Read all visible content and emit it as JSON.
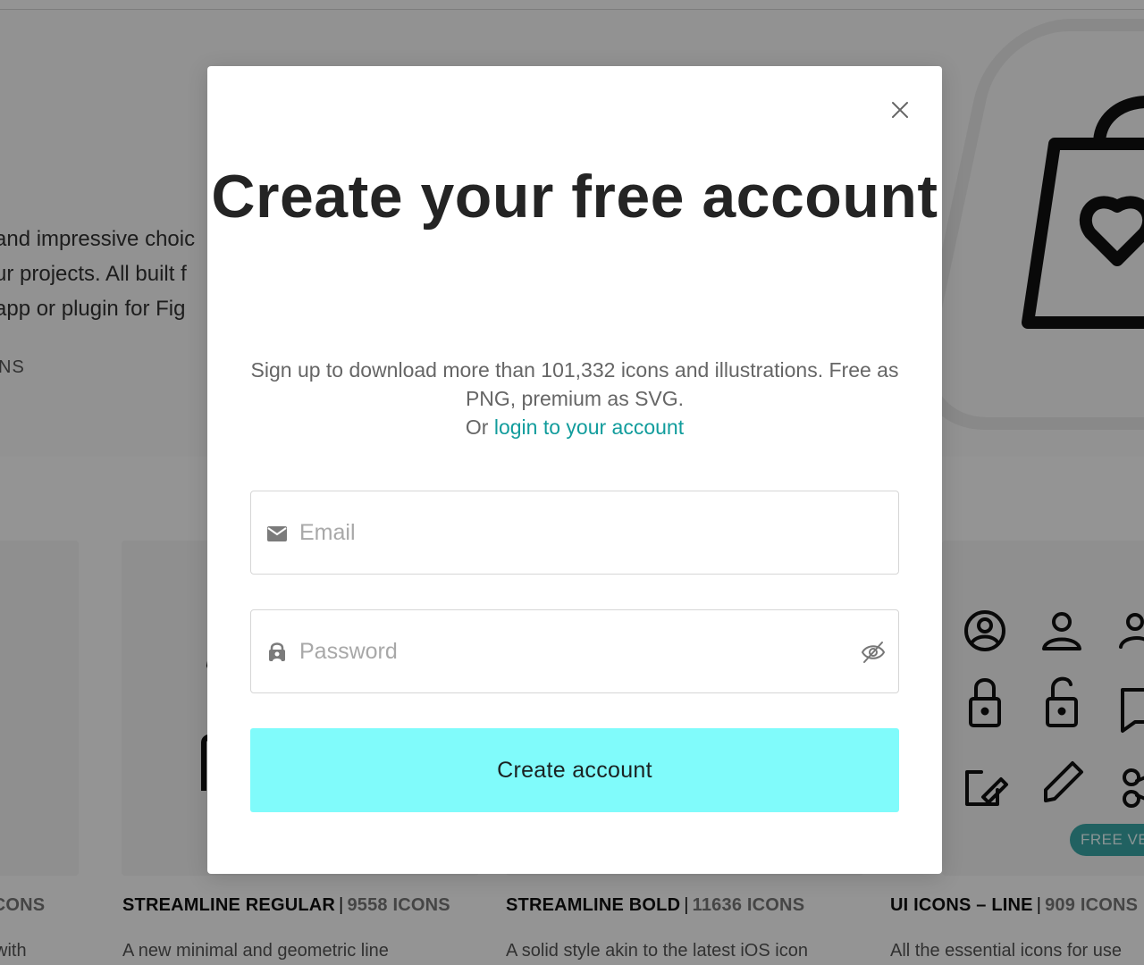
{
  "background": {
    "hero_lines": [
      "and impressive choic",
      "ur projects. All built f",
      "app or plugin for Fig"
    ],
    "hero_tag": "NS",
    "free_badge": "FREE VE",
    "collections": [
      {
        "name": "",
        "count": "ICONS",
        "desc": " with"
      },
      {
        "name": "STREAMLINE REGULAR",
        "count": "9558 ICONS",
        "desc": "A new minimal and geometric line"
      },
      {
        "name": "STREAMLINE BOLD",
        "count": "11636 ICONS",
        "desc": "A solid style akin to the latest iOS icon"
      },
      {
        "name": "UI ICONS – LINE",
        "count": "909 ICONS",
        "desc": "All the essential icons for use"
      }
    ]
  },
  "modal": {
    "title": "Create your free account",
    "subtitle": "Sign up to download more than 101,332 icons and illustrations. Free as PNG, premium as SVG.",
    "login_prefix": "Or ",
    "login_link": "login to your account",
    "email": {
      "placeholder": "Email",
      "value": ""
    },
    "password": {
      "placeholder": "Password",
      "value": ""
    },
    "submit_label": "Create account",
    "icons": {
      "close": "close-icon",
      "email": "envelope-icon",
      "password": "lock-person-icon",
      "toggle": "eye-off-icon"
    }
  },
  "colors": {
    "accent_link": "#119c9c",
    "button_bg": "#80fbfb",
    "overlay": "rgba(0,0,0,0.42)"
  }
}
